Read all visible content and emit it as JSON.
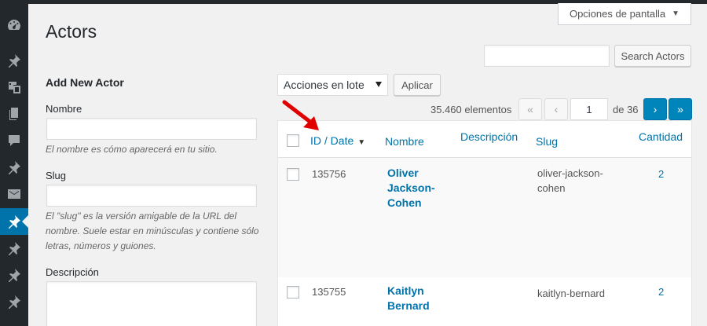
{
  "sidebar": {
    "icons": [
      {
        "name": "dashboard-icon"
      },
      {
        "name": "pin-icon"
      },
      {
        "name": "media-icon"
      },
      {
        "name": "pages-icon"
      },
      {
        "name": "comments-icon"
      },
      {
        "name": "pin-icon"
      },
      {
        "name": "mail-icon"
      },
      {
        "name": "pin-icon",
        "active": true
      },
      {
        "name": "pin-icon"
      },
      {
        "name": "pin-icon"
      },
      {
        "name": "pin-icon"
      }
    ]
  },
  "screen_options": {
    "label": "Opciones de pantalla"
  },
  "page": {
    "title": "Actors"
  },
  "search": {
    "value": "",
    "button_label": "Search Actors"
  },
  "form": {
    "title": "Add New Actor",
    "name_label": "Nombre",
    "name_value": "",
    "name_help": "El nombre es cómo aparecerá en tu sitio.",
    "slug_label": "Slug",
    "slug_value": "",
    "slug_help": "El \"slug\" es la versión amigable de la URL del nombre. Suele estar en minúsculas y contiene sólo letras, números y guiones.",
    "description_label": "Descripción"
  },
  "bulk": {
    "selected": "Acciones en lote",
    "apply_label": "Aplicar"
  },
  "pagination": {
    "items_count": "35.460 elementos",
    "first": "«",
    "prev": "‹",
    "current_page": "1",
    "of_label": "de 36",
    "next": "›",
    "last": "»"
  },
  "table": {
    "columns": {
      "id": "ID / Date",
      "name": "Nombre",
      "description": "Descripción",
      "slug": "Slug",
      "count": "Cantidad"
    },
    "rows": [
      {
        "id": "135756",
        "name": "Oliver Jackson-Cohen",
        "description": "",
        "slug": "oliver-jackson-cohen",
        "count": "2"
      },
      {
        "id": "135755",
        "name": "Kaitlyn Bernard",
        "description": "",
        "slug": "kaitlyn-bernard",
        "count": "2"
      }
    ]
  },
  "colors": {
    "accent": "#0073aa",
    "sidebar": "#23282d",
    "arrow": "#e00000"
  }
}
